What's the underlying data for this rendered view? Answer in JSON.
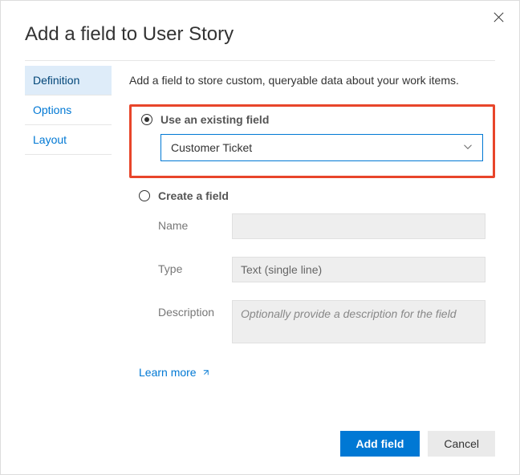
{
  "dialog": {
    "title": "Add a field to User Story"
  },
  "sidebar": {
    "items": [
      {
        "label": "Definition",
        "active": true
      },
      {
        "label": "Options",
        "active": false
      },
      {
        "label": "Layout",
        "active": false
      }
    ]
  },
  "main": {
    "intro": "Add a field to store custom, queryable data about your work items.",
    "existing": {
      "radio_label": "Use an existing field",
      "selected_field": "Customer Ticket"
    },
    "create": {
      "radio_label": "Create a field",
      "name_label": "Name",
      "name_value": "",
      "type_label": "Type",
      "type_value": "Text (single line)",
      "description_label": "Description",
      "description_placeholder": "Optionally provide a description for the field"
    },
    "learn_more": "Learn more"
  },
  "footer": {
    "primary": "Add field",
    "secondary": "Cancel"
  }
}
